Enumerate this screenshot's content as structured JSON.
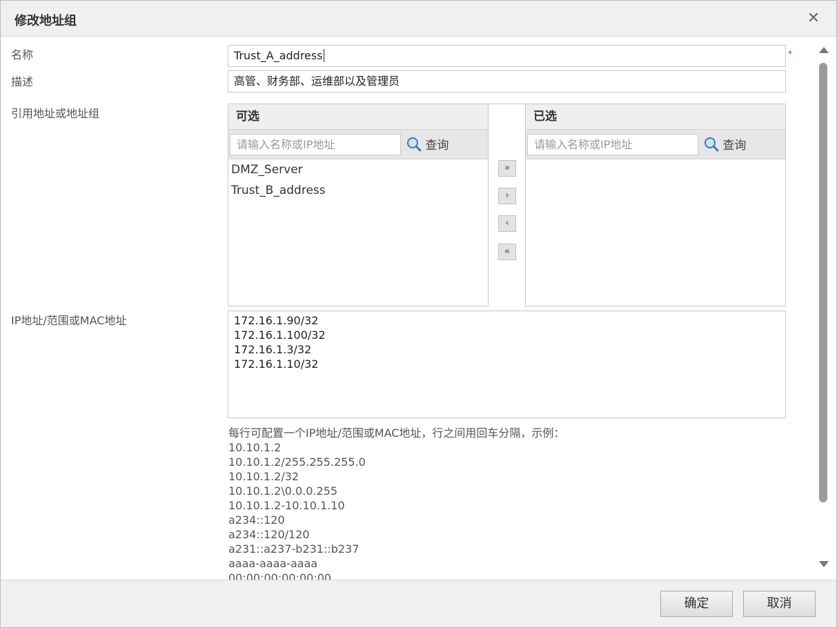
{
  "dialog": {
    "title": "修改地址组"
  },
  "form": {
    "name_label": "名称",
    "name_value": "Trust_A_address",
    "required_mark": "*",
    "desc_label": "描述",
    "desc_value": "高管、财务部、运维部以及管理员",
    "ref_label": "引用地址或地址组",
    "ip_label": "IP地址/范围或MAC地址",
    "ip_lines": [
      "172.16.1.90/32",
      "172.16.1.100/32",
      "172.16.1.3/32",
      "172.16.1.10/32"
    ]
  },
  "available": {
    "header": "可选",
    "search_placeholder": "请输入名称或IP地址",
    "search_label": "查询",
    "items": [
      "DMZ_Server",
      "Trust_B_address"
    ]
  },
  "selected": {
    "header": "已选",
    "search_placeholder": "请输入名称或IP地址",
    "search_label": "查询",
    "items": []
  },
  "transfer": {
    "add_all": "»",
    "add": "›",
    "remove": "‹",
    "remove_all": "«"
  },
  "hint": {
    "intro": "每行可配置一个IP地址/范围或MAC地址，行之间用回车分隔，示例：",
    "examples": [
      "10.10.1.2",
      "10.10.1.2/255.255.255.0",
      "10.10.1.2/32",
      "10.10.1.2\\0.0.0.255",
      "10.10.1.2-10.10.1.10",
      "a234::120",
      "a234::120/120",
      "a231::a237-b231::b237",
      "aaaa-aaaa-aaaa",
      "00:00:00:00:00:00"
    ]
  },
  "footer": {
    "ok_label": "确定",
    "cancel_label": "取消"
  },
  "icons": {
    "close": "close-icon",
    "search": "search-icon"
  }
}
